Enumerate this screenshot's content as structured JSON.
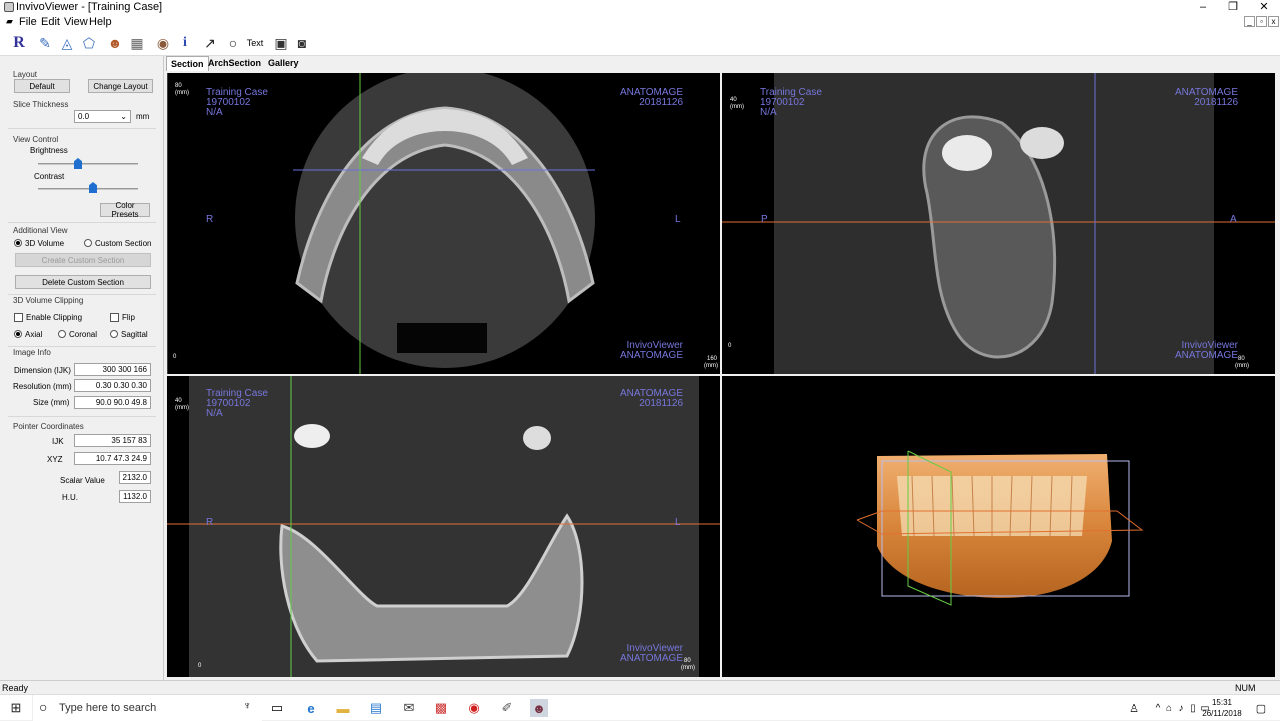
{
  "window": {
    "title": "InvivoViewer - [Training Case]",
    "minimize": "–",
    "restore": "❐",
    "close": "✕"
  },
  "menu": [
    "File",
    "Edit",
    "View",
    "Help"
  ],
  "toolbar": {
    "text_tool": "Text"
  },
  "tabs": [
    "Section",
    "ArchSection",
    "Gallery"
  ],
  "left_panel": {
    "layout": {
      "title": "Layout",
      "default_label": "Default",
      "change_label": "Change Layout"
    },
    "slice_thickness": {
      "title": "Slice Thickness",
      "value": "0.0",
      "unit": "mm"
    },
    "view_control": {
      "title": "View Control",
      "brightness": "Brightness",
      "contrast": "Contrast",
      "brightness_level": 0.4,
      "contrast_level": 0.55,
      "color_presets": "Color Presets"
    },
    "additional_view": {
      "title": "Additional View",
      "volume": "3D Volume",
      "custom": "Custom Section",
      "create": "Create Custom Section",
      "delete": "Delete Custom Section"
    },
    "clipping": {
      "title": "3D Volume Clipping",
      "enable": "Enable Clipping",
      "flip": "Flip",
      "axial": "Axial",
      "coronal": "Coronal",
      "sagittal": "Sagittal"
    },
    "image_info": {
      "title": "Image Info",
      "dimension_label": "Dimension (IJK)",
      "dimension_value": "300  300  166",
      "resolution_label": "Resolution (mm)",
      "resolution_value": "0.30  0.30  0.30",
      "size_label": "Size (mm)",
      "size_value": "90.0  90.0  49.8"
    },
    "pointer": {
      "title": "Pointer Coordinates",
      "ijk_label": "IJK",
      "ijk_value": "35  157  83",
      "xyz_label": "XYZ",
      "xyz_value": "10.7  47.3  24.9",
      "scalar_label": "Scalar Value",
      "scalar_value": "2132.0",
      "hu_label": "H.U.",
      "hu_value": "1132.0"
    }
  },
  "viewports": {
    "axial": {
      "case": "Training Case",
      "id": "19700102",
      "na": "N/A",
      "brand": "ANATOMAGE",
      "date": "20181126",
      "viewer": "InvivoViewer",
      "left": "R",
      "right": "L",
      "unit": "(mm)",
      "top_scale": "80",
      "zero": "0",
      "end_scale": "160"
    },
    "sagittal": {
      "case": "Training Case",
      "id": "19700102",
      "na": "N/A",
      "brand": "ANATOMAGE",
      "date": "20181126",
      "viewer": "InvivoViewer",
      "left": "P",
      "right": "A",
      "unit": "(mm)",
      "top_scale": "40",
      "zero": "0",
      "end_scale": "80"
    },
    "coronal": {
      "case": "Training Case",
      "id": "19700102",
      "na": "N/A",
      "brand": "ANATOMAGE",
      "date": "20181126",
      "viewer": "InvivoViewer",
      "left": "R",
      "right": "L",
      "unit": "(mm)",
      "top_scale": "40",
      "zero": "0",
      "end_scale": "80"
    }
  },
  "status": {
    "text": "Ready",
    "num": "NUM"
  },
  "taskbar": {
    "search_placeholder": "Type here to search",
    "time": "15:31",
    "date": "26/11/2018"
  },
  "colors": {
    "crosshair_green": "#66cc44",
    "crosshair_blue": "#6d72d9",
    "crosshair_orange": "#e07030",
    "overlay_text": "#7777dd"
  }
}
